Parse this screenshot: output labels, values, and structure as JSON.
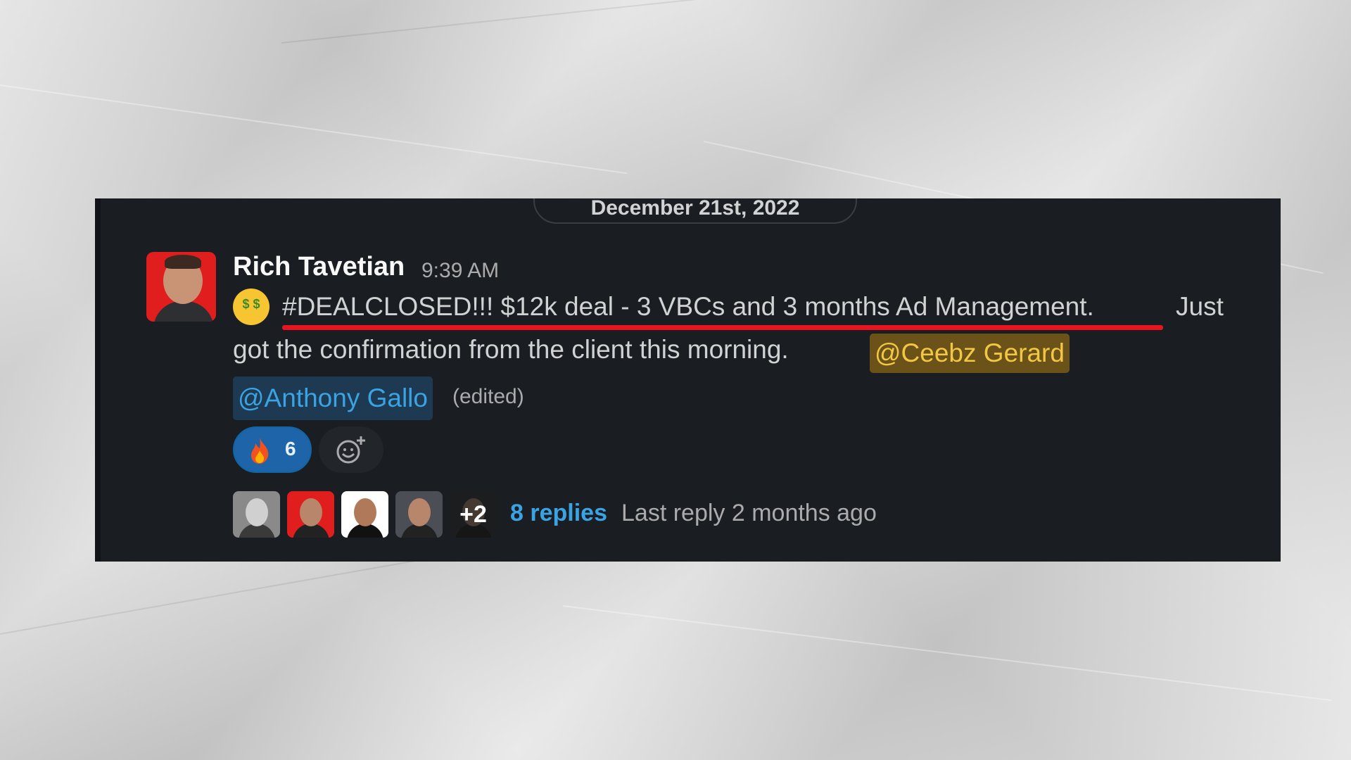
{
  "date_divider": "December 21st, 2022",
  "message": {
    "author": "Rich Tavetian",
    "time": "9:39 AM",
    "text_line1": "#DEALCLOSED!!! $12k deal - 3 VBCs and 3 months Ad Management.",
    "text_line1_tail": "Just",
    "text_line2": "got the confirmation from the client this morning.",
    "mention_1": "@Ceebz Gerard",
    "mention_2": "@Anthony Gallo",
    "edited_label": "(edited)",
    "emoji": "money-mouth-face"
  },
  "reactions": [
    {
      "emoji": "fire",
      "count": "6"
    }
  ],
  "thread": {
    "extra_avatars": "+2",
    "replies_label": "8 replies",
    "last_reply": "Last reply 2 months ago"
  },
  "colors": {
    "panel_bg": "#1a1d21",
    "highlight_underline": "#e8141e",
    "mention_self_bg": "#6b5219",
    "mention_bg": "#1d3a52",
    "link_blue": "#3aa3e3"
  }
}
